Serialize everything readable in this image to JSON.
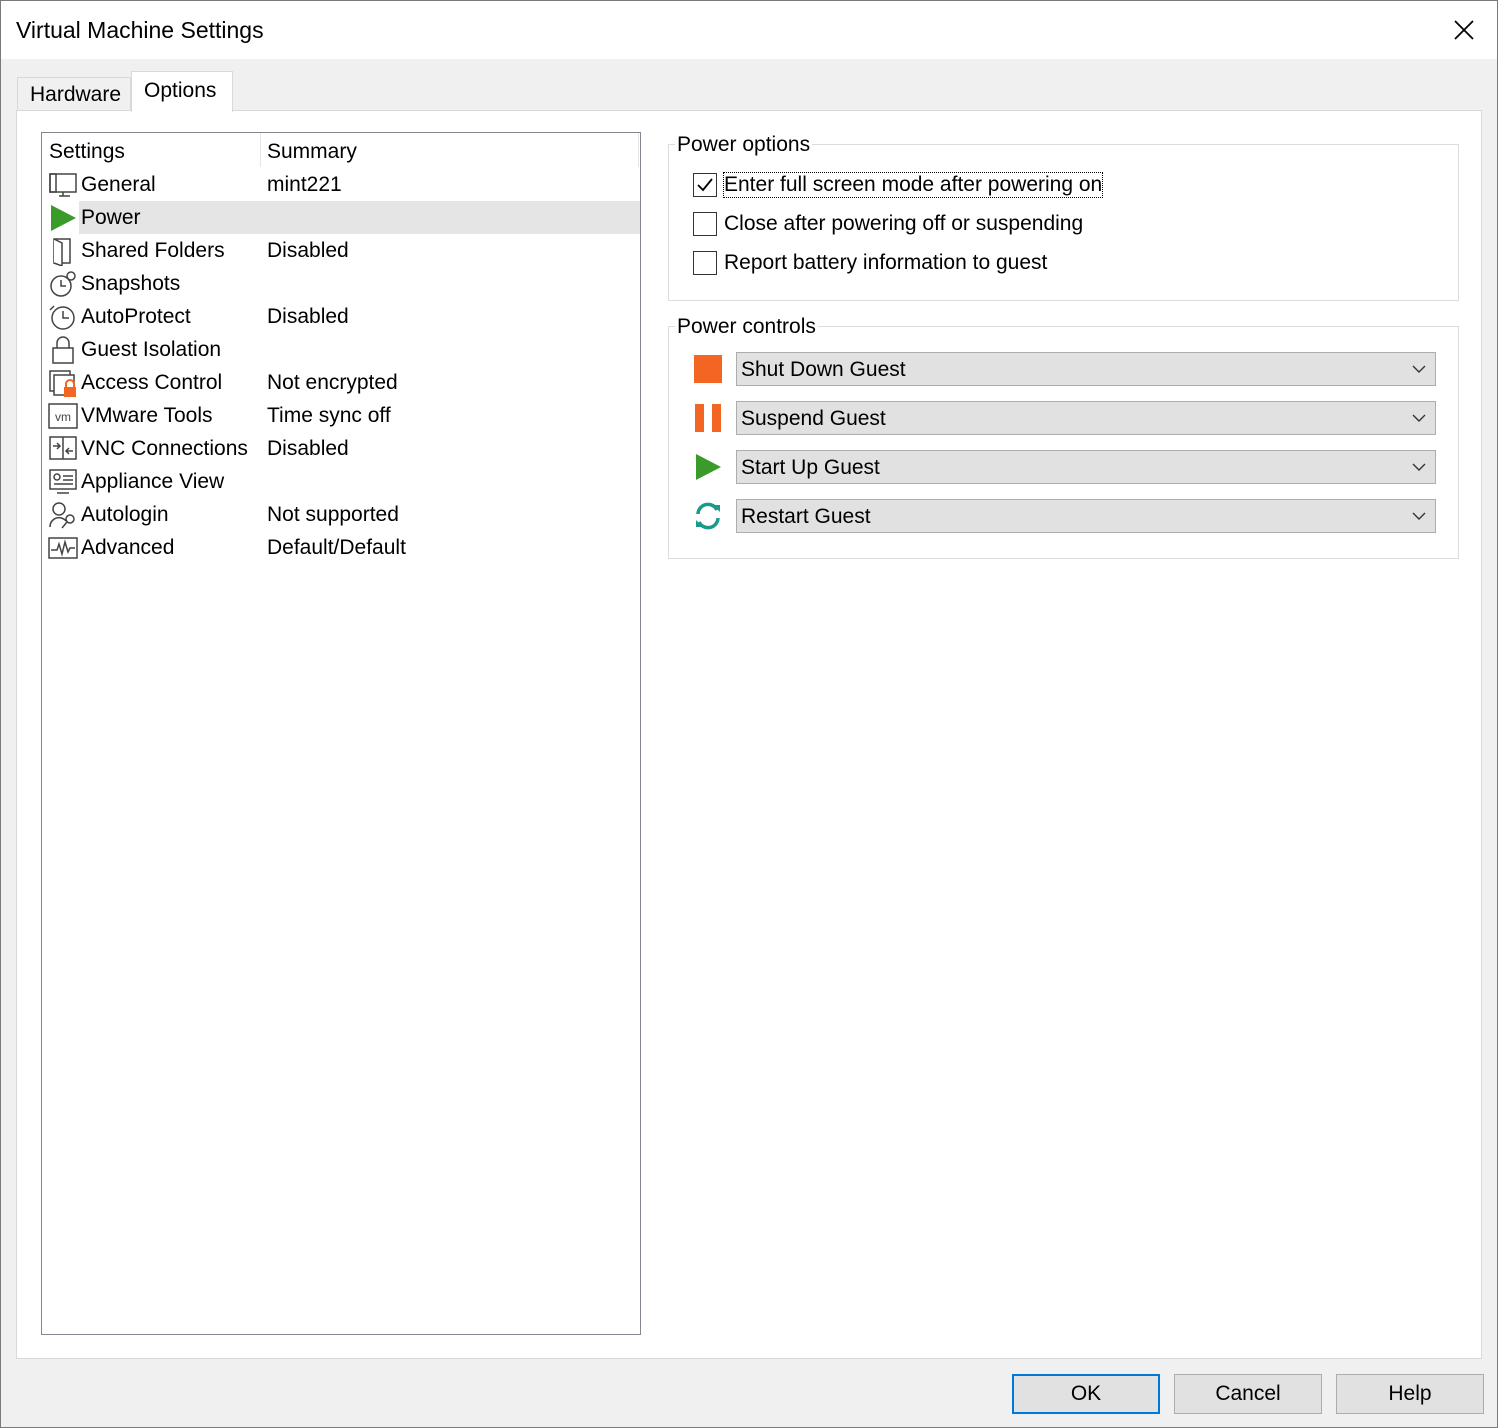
{
  "window": {
    "title": "Virtual Machine Settings",
    "close_icon": "close-icon"
  },
  "tabs": [
    {
      "label": "Hardware",
      "active": false
    },
    {
      "label": "Options",
      "active": true
    }
  ],
  "settings_list": {
    "headers": {
      "settings": "Settings",
      "summary": "Summary"
    },
    "items": [
      {
        "icon": "monitor-icon",
        "name": "General",
        "summary": "mint221"
      },
      {
        "icon": "play-icon",
        "name": "Power",
        "summary": "",
        "selected": true
      },
      {
        "icon": "shared-folder-icon",
        "name": "Shared Folders",
        "summary": "Disabled"
      },
      {
        "icon": "snapshot-icon",
        "name": "Snapshots",
        "summary": ""
      },
      {
        "icon": "clock-icon",
        "name": "AutoProtect",
        "summary": "Disabled"
      },
      {
        "icon": "lock-icon",
        "name": "Guest Isolation",
        "summary": ""
      },
      {
        "icon": "access-control-icon",
        "name": "Access Control",
        "summary": "Not encrypted"
      },
      {
        "icon": "vm-tools-icon",
        "name": "VMware Tools",
        "summary": "Time sync off"
      },
      {
        "icon": "vnc-icon",
        "name": "VNC Connections",
        "summary": "Disabled"
      },
      {
        "icon": "appliance-view-icon",
        "name": "Appliance View",
        "summary": ""
      },
      {
        "icon": "autologin-icon",
        "name": "Autologin",
        "summary": "Not supported"
      },
      {
        "icon": "advanced-icon",
        "name": "Advanced",
        "summary": "Default/Default"
      }
    ]
  },
  "power_options": {
    "label": "Power options",
    "checkboxes": [
      {
        "label": "Enter full screen mode after powering on",
        "checked": true
      },
      {
        "label": "Close after powering off or suspending",
        "checked": false
      },
      {
        "label": "Report battery information to guest",
        "checked": false
      }
    ]
  },
  "power_controls": {
    "label": "Power controls",
    "controls": [
      {
        "icon": "stop-icon",
        "value": "Shut Down Guest",
        "color": "#f26522"
      },
      {
        "icon": "pause-icon",
        "value": "Suspend Guest",
        "color": "#f26522"
      },
      {
        "icon": "play-icon",
        "value": "Start Up Guest",
        "color": "#3a9a2a"
      },
      {
        "icon": "restart-icon",
        "value": "Restart Guest",
        "color": "#1a9a8a"
      }
    ]
  },
  "buttons": {
    "ok": "OK",
    "cancel": "Cancel",
    "help": "Help"
  }
}
